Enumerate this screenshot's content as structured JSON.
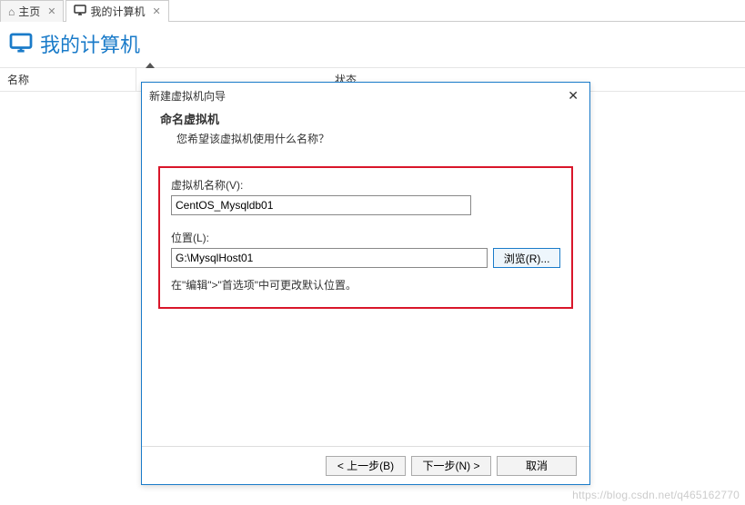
{
  "tabs": {
    "home": "主页",
    "mycomputer": "我的计算机"
  },
  "header": {
    "title": "我的计算机"
  },
  "columns": {
    "name": "名称",
    "status": "状态"
  },
  "dialog": {
    "title": "新建虚拟机向导",
    "heading": "命名虚拟机",
    "subheading": "您希望该虚拟机使用什么名称？",
    "vm_name_label": "虚拟机名称(V):",
    "vm_name_value": "CentOS_Mysqldb01",
    "location_label": "位置(L):",
    "location_value": "G:\\MysqlHost01",
    "browse_label": "浏览(R)...",
    "hint": "在\"编辑\">\"首选项\"中可更改默认位置。",
    "back": "< 上一步(B)",
    "next": "下一步(N) >",
    "cancel": "取消"
  },
  "watermark": "https://blog.csdn.net/q465162770"
}
